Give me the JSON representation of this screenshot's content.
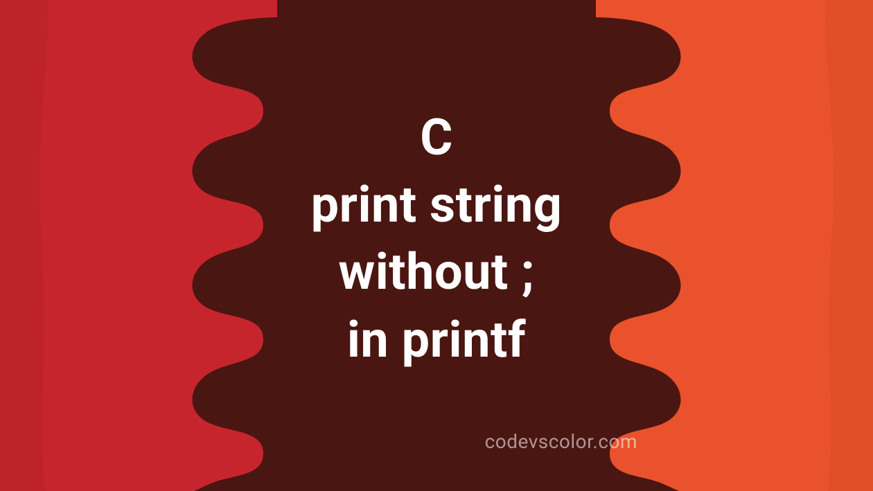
{
  "banner": {
    "title_lines": {
      "l1": "C",
      "l2": "print string",
      "l3": "without ;",
      "l4": "in printf"
    },
    "watermark": "codevscolor.com",
    "colors": {
      "background_center": "#4a1612",
      "left_shape": "#c7252d",
      "right_shape": "#e9522c",
      "text": "#ffffff",
      "watermark": "rgba(255,255,255,0.55)"
    }
  }
}
